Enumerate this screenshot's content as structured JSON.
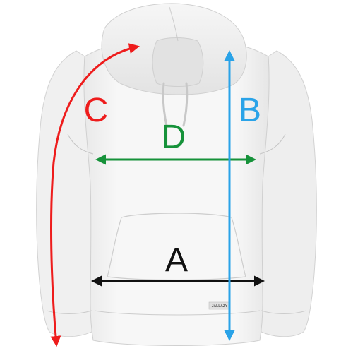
{
  "garment": {
    "fabric_color": "#f4f4f4",
    "shadow_color": "#d9d9d9",
    "seam_color": "#c4c4c4",
    "brand_tag_text": "JALLAZY"
  },
  "dimensions": [
    {
      "key": "a",
      "letter": "A",
      "color": "#111111"
    },
    {
      "key": "b",
      "letter": "B",
      "color": "#2aa3e8"
    },
    {
      "key": "c",
      "letter": "C",
      "color": "#ee1c1c"
    },
    {
      "key": "d",
      "letter": "D",
      "color": "#16923a"
    }
  ]
}
